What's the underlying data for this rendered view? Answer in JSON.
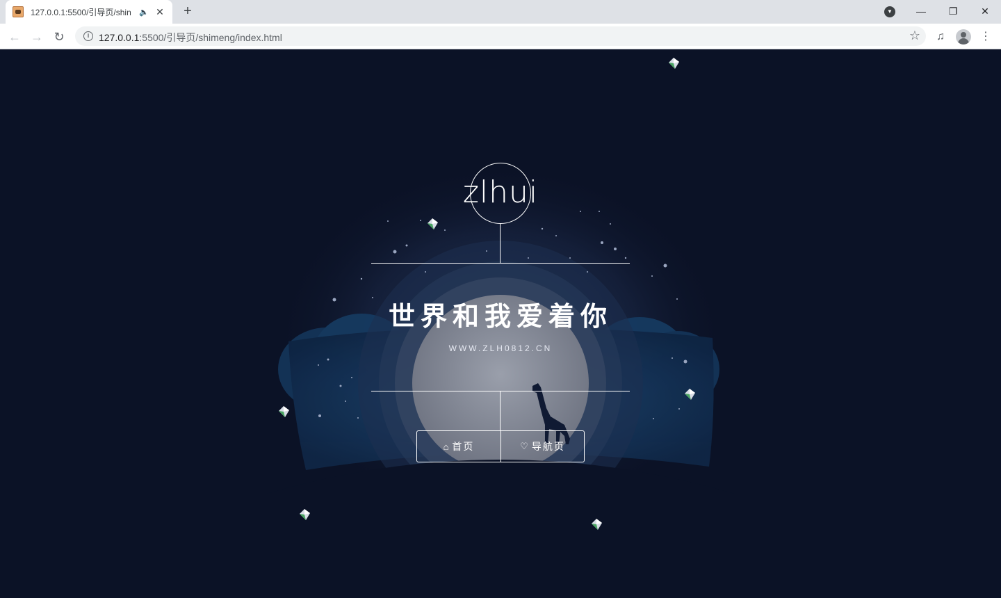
{
  "browser": {
    "tab_title": "127.0.0.1:5500/引导页/shimeng/index.html",
    "tab_title_visible": "127.0.0.1:5500/引导页/shin",
    "url_host": "127.0.0.1",
    "url_rest": ":5500/引导页/shimeng/index.html"
  },
  "page": {
    "logo_text": "zlhui",
    "title": "世界和我爱着你",
    "subtitle": "WWW.ZLH0812.CN",
    "buttons": [
      {
        "label": "首页",
        "icon": "home-icon"
      },
      {
        "label": "导航页",
        "icon": "heart-icon"
      }
    ]
  },
  "colors": {
    "background": "#0b1226",
    "moon": "#8a8f9c",
    "clouds": "#14345a",
    "line": "#ffffff"
  }
}
